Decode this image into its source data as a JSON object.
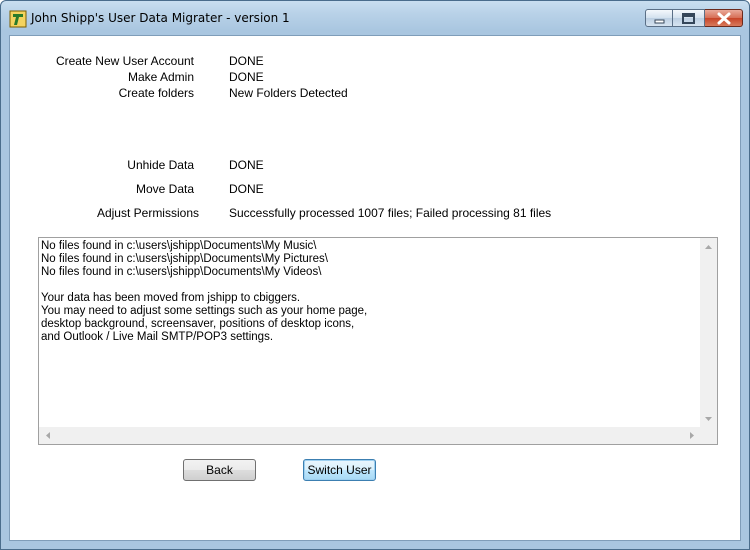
{
  "window": {
    "title": "John Shipp's User Data Migrater - version 1"
  },
  "steps": [
    {
      "label": "Create New User Account",
      "status": "DONE"
    },
    {
      "label": "Make Admin",
      "status": "DONE"
    },
    {
      "label": "Create folders",
      "status": "New Folders Detected"
    },
    {
      "label": "Unhide Data",
      "status": "DONE"
    },
    {
      "label": "Move Data",
      "status": "DONE"
    },
    {
      "label": "Adjust Permissions",
      "status": "Successfully processed 1007 files; Failed processing 81 files"
    }
  ],
  "log": {
    "text": "No files found in c:\\users\\jshipp\\Documents\\My Music\\\nNo files found in c:\\users\\jshipp\\Documents\\My Pictures\\\nNo files found in c:\\users\\jshipp\\Documents\\My Videos\\\n\nYour data has been moved from jshipp to cbiggers.\nYou may need to adjust some settings such as your home page,\ndesktop background, screensaver, positions of desktop icons,\nand Outlook / Live Mail SMTP/POP3 settings."
  },
  "buttons": {
    "back": "Back",
    "switch_user": "Switch User"
  },
  "icons": {
    "app": "app-icon",
    "minimize": "minimize-icon",
    "maximize": "maximize-icon",
    "close": "close-icon"
  }
}
